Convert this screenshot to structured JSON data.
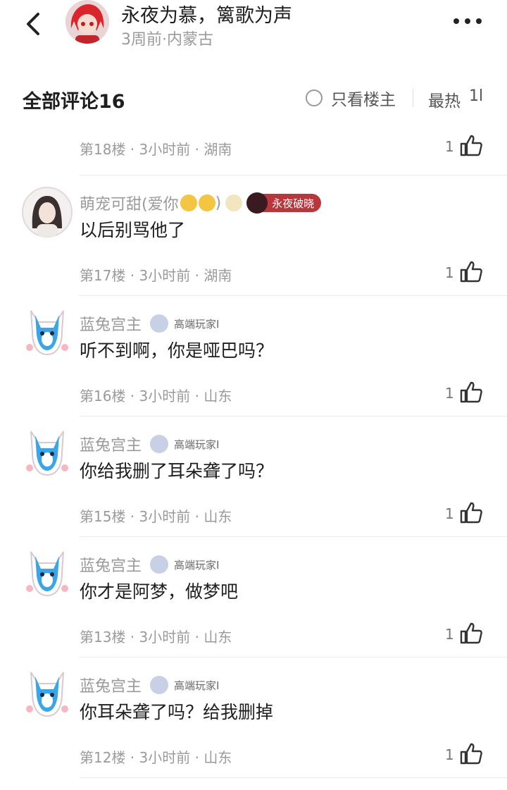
{
  "header": {
    "title": "永夜为慕，篱歌为声",
    "meta": "3周前·内蒙古"
  },
  "toolbar": {
    "all_comments": "全部评论16",
    "only_op": "只看楼主",
    "sort": "最热",
    "sort_icon": "1l"
  },
  "top_partial": {
    "meta": "第18楼 · 3小时前 · 湖南",
    "likes": "1"
  },
  "comments": [
    {
      "name": "萌宠可甜(爱你",
      "name_suffix": ")",
      "badge": "永夜破晓",
      "text": "以后别骂他了",
      "meta": "第17楼 · 3小时前 · 湖南",
      "likes": "1"
    },
    {
      "name": "蓝兔宫主",
      "tag": "高端玩家I",
      "text": "听不到啊，你是哑巴吗？",
      "meta": "第16楼 · 3小时前 · 山东",
      "likes": "1"
    },
    {
      "name": "蓝兔宫主",
      "tag": "高端玩家I",
      "text": "你给我删了耳朵聋了吗？",
      "meta": "第15楼 · 3小时前 · 山东",
      "likes": "1"
    },
    {
      "name": "蓝兔宫主",
      "tag": "高端玩家I",
      "text": "你才是阿梦，做梦吧",
      "meta": "第13楼 · 3小时前 · 山东",
      "likes": "1"
    },
    {
      "name": "蓝兔宫主",
      "tag": "高端玩家I",
      "text": "你耳朵聋了吗？给我删掉",
      "meta": "第12楼 · 3小时前 · 山东",
      "likes": "1"
    }
  ],
  "colors": {
    "badge_red": "#b8373c",
    "text_gray": "#9a9a9a"
  }
}
